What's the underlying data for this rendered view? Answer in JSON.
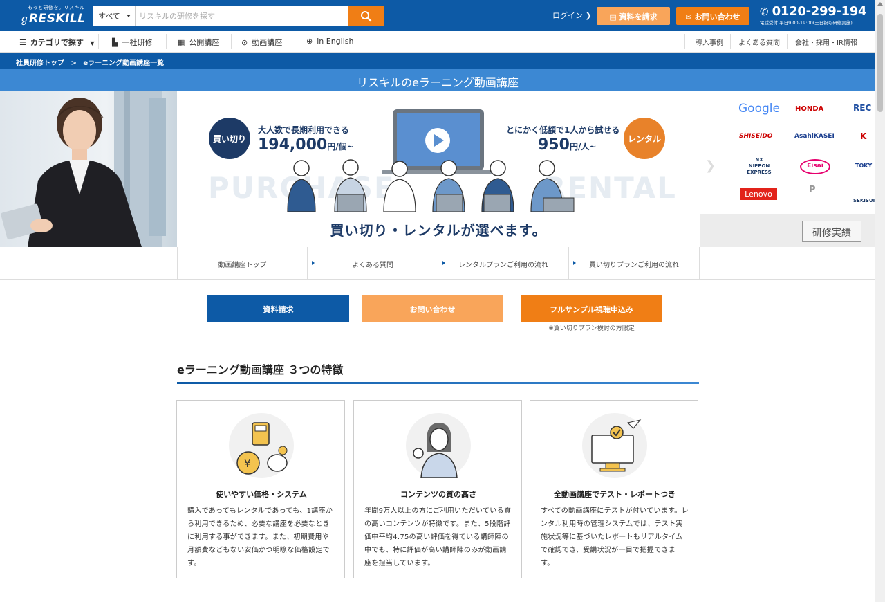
{
  "header": {
    "logo_tagline": "もっと研修を。リスキル",
    "logo_name": "RESKILL",
    "search_category": "すべて",
    "search_placeholder": "リスキルの研修を探す",
    "login_label": "ログイン",
    "request_label": "資料を請求",
    "contact_label": "お問い合わせ",
    "phone_number": "0120-299-194",
    "phone_hours": "電話受付 平日9:00-19:00(土日祝も研修実施)"
  },
  "nav": {
    "category_label": "カテゴリで探す",
    "items": [
      "一社研修",
      "公開講座",
      "動画講座",
      "in English"
    ],
    "right_items": [
      "導入事例",
      "よくある質問",
      "会社・採用・IR情報"
    ]
  },
  "breadcrumb": [
    "社員研修トップ",
    ">",
    "eラーニング動画講座一覧"
  ],
  "banner_title": "リスキルのeラーニング動画講座",
  "hero": {
    "purchase_badge": "買い切り",
    "purchase_sub": "大人数で長期利用できる",
    "purchase_price": "194,000",
    "purchase_unit": "円/個~",
    "rental_badge": "レンタル",
    "rental_sub": "とにかく低額で1人から試せる",
    "rental_price": "950",
    "rental_unit": "円/人~",
    "bg_word_left": "PURCHASE",
    "bg_word_right": "RENTAL",
    "catch": "買い切り・レンタルが選べます。"
  },
  "logos": [
    "Google",
    "HONDA",
    "REC",
    "SHISEIDO",
    "AsahiKASEI",
    "K",
    "NX NIPPON EXPRESS",
    "Eisai",
    "TOKY",
    "Lenovo",
    "P",
    "SEKISUI"
  ],
  "record_button": "研修実績",
  "subnav": [
    "動画講座トップ",
    "よくある質問",
    "レンタルプランご利用の流れ",
    "買い切りプランご利用の流れ"
  ],
  "cta": {
    "request": "資料請求",
    "contact": "お問い合わせ",
    "sample": "フルサンプル視聴申込み",
    "note": "※買い切りプラン検討の方限定"
  },
  "section_title": "eラーニング動画講座 ３つの特徴",
  "features": [
    {
      "title": "使いやすい価格・システム",
      "body": "購入であってもレンタルであっても、1講座から利用できるため、必要な講座を必要なときに利用する事ができます。また、初期費用や月額費などもない安価かつ明瞭な価格設定です。"
    },
    {
      "title": "コンテンツの質の高さ",
      "body": "年間9万人以上の方にご利用いただいている質の高いコンテンツが特徴です。また、5段階評価中平均4.75の高い評価を得ている講師陣の中でも、特に評価が高い講師陣のみが動画講座を担当しています。"
    },
    {
      "title": "全動画講座でテスト・レポートつき",
      "body": "すべての動画講座にテストが付いています。レンタル利用時の管理システムでは、テスト実施状況等に基づいたレポートもリアルタイムで確認でき、受講状況が一目で把握できます。"
    }
  ],
  "colors": {
    "primary_blue": "#0d5aa6",
    "light_blue": "#3c88d3",
    "orange": "#f07e15",
    "light_orange": "#f9a55a",
    "navy": "#1d3a66"
  }
}
